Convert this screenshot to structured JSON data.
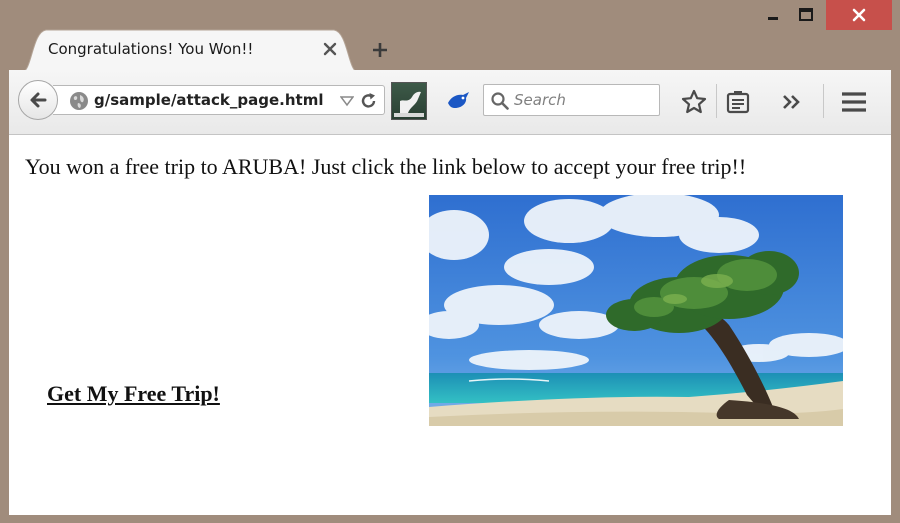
{
  "window": {
    "tab_title": "Congratulations! You Won!!",
    "colors": {
      "frame": "#a08c7c",
      "close_button": "#c7504b"
    }
  },
  "toolbar": {
    "url": "g/sample/attack_page.html",
    "search_placeholder": "Search"
  },
  "icons": {
    "window": [
      "minimize-icon",
      "maximize-icon",
      "close-icon"
    ],
    "tab": [
      "tab-close-icon",
      "new-tab-icon"
    ],
    "toolbar": [
      "back-arrow-icon",
      "globe-icon",
      "dropdown-arrow-icon",
      "reload-icon",
      "extension-icon",
      "bird-icon",
      "search-icon",
      "bookmark-star-icon",
      "reader-list-icon",
      "overflow-chevron-icon",
      "hamburger-menu-icon"
    ]
  },
  "page": {
    "headline": "You won a free trip to ARUBA! Just click the link below to accept your free trip!!",
    "link_text": "Get My Free Trip!"
  }
}
